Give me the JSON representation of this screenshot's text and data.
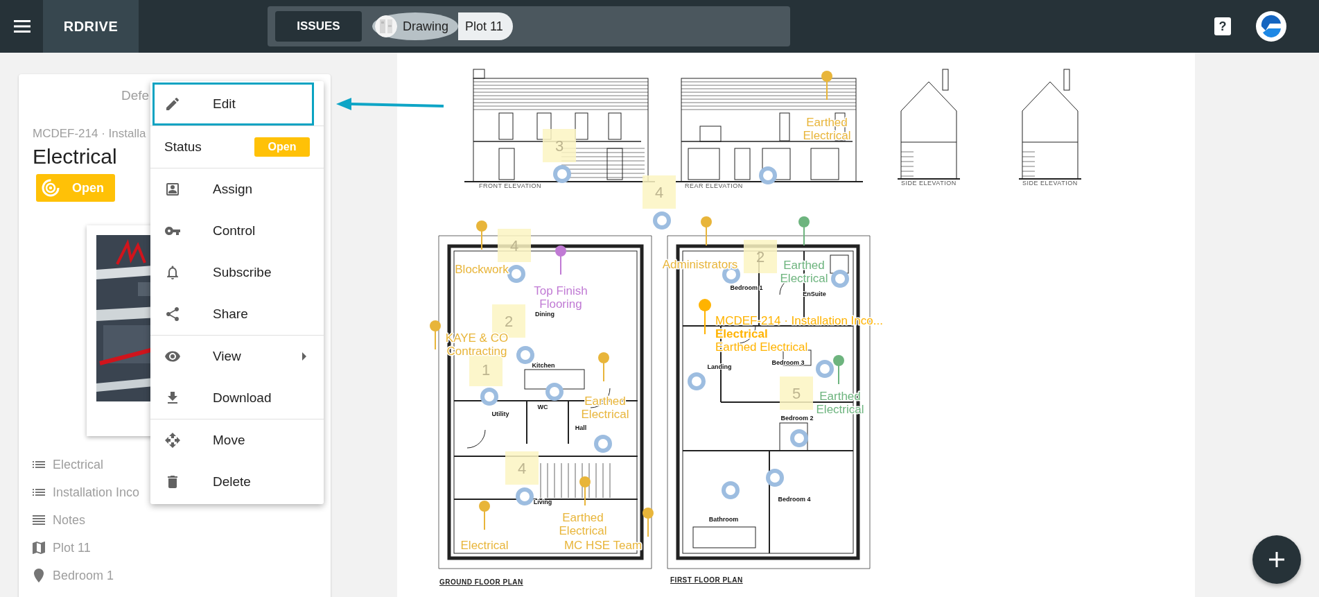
{
  "top_bar": {
    "app_name": "RDRIVE",
    "issues_button": "ISSUES",
    "breadcrumbs": [
      {
        "kind": "thumb",
        "label": "Drawing"
      },
      {
        "kind": "plain",
        "label": "Plot 11"
      }
    ],
    "help": "?"
  },
  "card": {
    "header": "Defe",
    "reference": "MCDEF-214 · Installa",
    "title": "Electrical",
    "status": "Open",
    "details": [
      {
        "kind": "list",
        "text": "Electrical"
      },
      {
        "kind": "list",
        "text": "Installation Inco"
      },
      {
        "kind": "notes",
        "text": "Notes"
      },
      {
        "kind": "map",
        "text": "Plot 11"
      },
      {
        "kind": "pin",
        "text": "Bedroom 1"
      }
    ]
  },
  "menu": {
    "groups": [
      [
        {
          "kind": "edit",
          "label": "Edit",
          "selected": true,
          "submenu": false
        }
      ],
      [
        {
          "kind": "status",
          "label": "Status",
          "value": "Open",
          "selected": false,
          "submenu": false
        }
      ],
      [
        {
          "kind": "assign",
          "label": "Assign",
          "selected": false,
          "submenu": false
        },
        {
          "kind": "control",
          "label": "Control",
          "selected": false,
          "submenu": false
        },
        {
          "kind": "subscribe",
          "label": "Subscribe",
          "selected": false,
          "submenu": false
        },
        {
          "kind": "share",
          "label": "Share",
          "selected": false,
          "submenu": false
        }
      ],
      [
        {
          "kind": "view",
          "label": "View",
          "selected": false,
          "submenu": true
        },
        {
          "kind": "download",
          "label": "Download",
          "selected": false,
          "submenu": false
        }
      ],
      [
        {
          "kind": "move",
          "label": "Move",
          "selected": false,
          "submenu": false
        },
        {
          "kind": "delete",
          "label": "Delete",
          "selected": false,
          "submenu": false
        }
      ]
    ]
  },
  "drawing": {
    "sheets": [
      {
        "kind": "front",
        "title": "FRONT ELEVATION"
      },
      {
        "kind": "rear",
        "title": "REAR ELEVATION"
      },
      {
        "kind": "side",
        "title": "SIDE ELEVATION"
      },
      {
        "kind": "side",
        "title": "SIDE ELEVATION"
      },
      {
        "kind": "ground",
        "title": "GROUND FLOOR PLAN"
      },
      {
        "kind": "first",
        "title": "FIRST FLOOR PLAN"
      }
    ],
    "rooms": [
      "Dining",
      "Kitchen",
      "WC",
      "Utility",
      "Hall",
      "Living",
      "Bedroom 1",
      "EnSuite",
      "Bedroom 3",
      "Landing",
      "Bedroom 2",
      "Bedroom 4",
      "Bathroom"
    ],
    "notes": [
      "3",
      "4",
      "4",
      "2",
      "2",
      "1",
      "4",
      "5"
    ],
    "pins": [
      {
        "kind": "tag",
        "lines": [
          "Earthed",
          "Electrical"
        ],
        "color": "#e8b53a"
      },
      {
        "kind": "tag",
        "lines": [
          "Blockwork"
        ],
        "color": "#e8b53a"
      },
      {
        "kind": "tag",
        "lines": [
          "Top Finish",
          "Flooring"
        ],
        "color": "#c07ad4"
      },
      {
        "kind": "tag",
        "lines": [
          "Administrators"
        ],
        "color": "#e8b53a"
      },
      {
        "kind": "tag",
        "lines": [
          "Earthed",
          "Electrical"
        ],
        "color": "#6db47e"
      },
      {
        "kind": "tag",
        "lines": [
          "KAYE & CO",
          "Contracting"
        ],
        "color": "#e8b53a"
      },
      {
        "kind": "active",
        "lines": [
          "MCDEF-214 · Installation Inco...",
          "Electrical",
          "Earthed Electrical"
        ],
        "color": "#ffb300"
      },
      {
        "kind": "tag",
        "lines": [
          "Earthed",
          "Electrical"
        ],
        "color": "#e8b53a"
      },
      {
        "kind": "tag",
        "lines": [
          "Earthed",
          "Electrical"
        ],
        "color": "#6db47e"
      },
      {
        "kind": "tag",
        "lines": [
          "Earthed",
          "Electrical"
        ],
        "color": "#e8b53a"
      },
      {
        "kind": "tag",
        "lines": [
          "Electrical"
        ],
        "color": "#e8b53a"
      },
      {
        "kind": "tag",
        "lines": [
          "MC HSE Team"
        ],
        "color": "#e8b53a"
      }
    ]
  }
}
